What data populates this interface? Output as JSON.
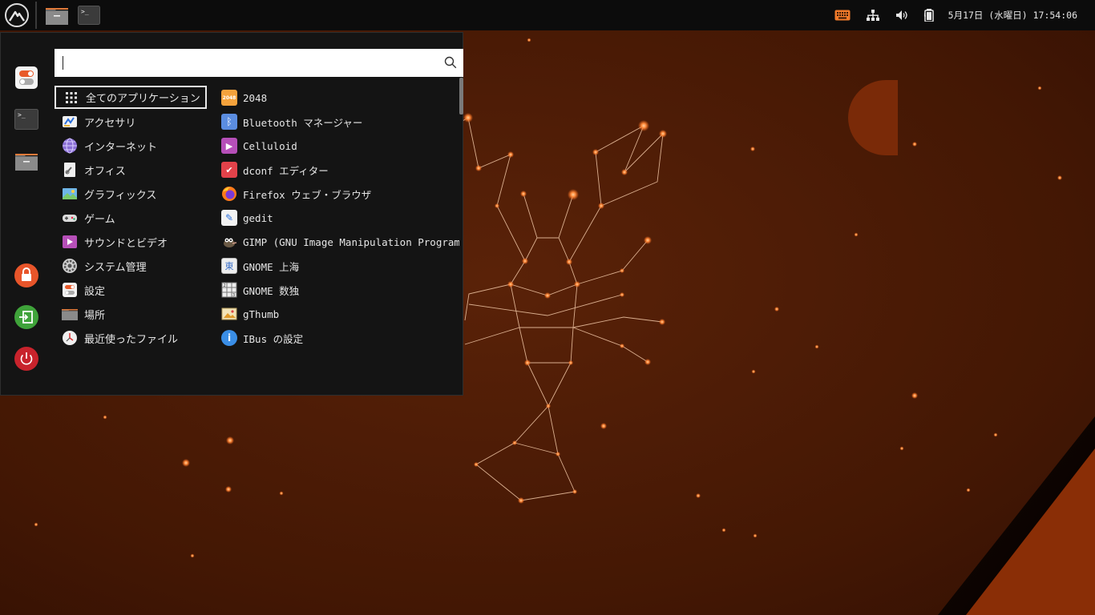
{
  "panel": {
    "clock": "5月17日 (水曜日) 17:54:06"
  },
  "search": {
    "value": "",
    "placeholder": ""
  },
  "categories": [
    {
      "label": "全てのアプリケーション",
      "icon": "grid-icon"
    },
    {
      "label": "アクセサリ",
      "icon": "accessories-icon"
    },
    {
      "label": "インターネット",
      "icon": "internet-icon"
    },
    {
      "label": "オフィス",
      "icon": "office-icon"
    },
    {
      "label": "グラフィックス",
      "icon": "graphics-icon"
    },
    {
      "label": "ゲーム",
      "icon": "games-icon"
    },
    {
      "label": "サウンドとビデオ",
      "icon": "multimedia-icon"
    },
    {
      "label": "システム管理",
      "icon": "system-icon"
    },
    {
      "label": "設定",
      "icon": "settings-icon"
    },
    {
      "label": "場所",
      "icon": "folder-icon"
    },
    {
      "label": "最近使ったファイル",
      "icon": "recent-icon"
    }
  ],
  "apps": [
    {
      "label": "2048",
      "icon": "2048-icon",
      "badge": "2048",
      "color": "#f4a23c"
    },
    {
      "label": "Bluetooth マネージャー",
      "icon": "bluetooth-icon",
      "badge": "ᛒ",
      "color": "#5b8de0"
    },
    {
      "label": "Celluloid",
      "icon": "celluloid-icon",
      "badge": "▶",
      "color": "#b64fb8"
    },
    {
      "label": "dconf エディター",
      "icon": "dconf-icon",
      "badge": "✔",
      "color": "#e2424a"
    },
    {
      "label": "Firefox ウェブ・ブラウザ",
      "icon": "firefox-icon",
      "badge": "",
      "color": "#ff7a1a"
    },
    {
      "label": "gedit",
      "icon": "gedit-icon",
      "badge": "✎",
      "color": "#f2f2f2"
    },
    {
      "label": "GIMP (GNU Image Manipulation Program)",
      "icon": "gimp-icon",
      "badge": "◉",
      "color": "#6b5a45"
    },
    {
      "label": "GNOME 上海",
      "icon": "mahjongg-icon",
      "badge": "東",
      "color": "#eeeeee"
    },
    {
      "label": "GNOME 数独",
      "icon": "sudoku-icon",
      "badge": "▦",
      "color": "#dddddd"
    },
    {
      "label": "gThumb",
      "icon": "gthumb-icon",
      "badge": "▣",
      "color": "#e9c46a"
    },
    {
      "label": "IBus の設定",
      "icon": "ibus-icon",
      "badge": "i",
      "color": "#3a8ee6"
    }
  ]
}
